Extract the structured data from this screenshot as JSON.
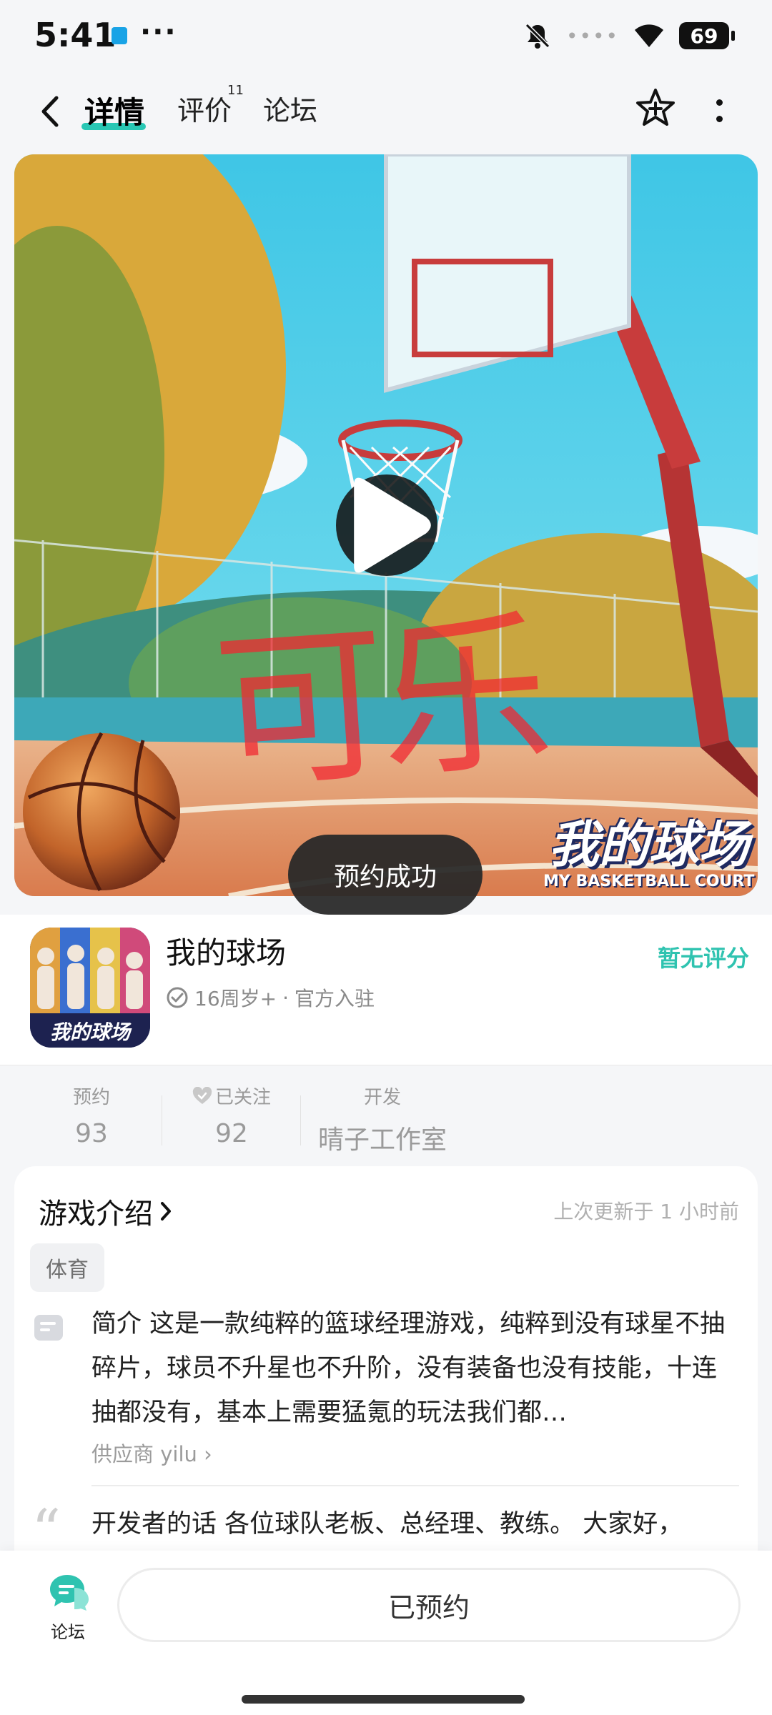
{
  "status_bar": {
    "time": "5:41",
    "more": "···",
    "signal_dots": "••••",
    "battery": "69"
  },
  "header": {
    "tabs": [
      {
        "label": "详情",
        "badge": ""
      },
      {
        "label": "评价",
        "badge": "11"
      },
      {
        "label": "论坛",
        "badge": ""
      }
    ]
  },
  "hero": {
    "watermark": "可乐",
    "logo_cn": "我的球场",
    "logo_en": "MY BASKETBALL COURT",
    "toast": "预约成功"
  },
  "game": {
    "name": "我的球场",
    "age_rating": "16周岁+",
    "official": "官方入驻",
    "rating": "暂无评分",
    "icon_caption": "我的球场"
  },
  "stats": [
    {
      "label": "预约",
      "value": "93"
    },
    {
      "label": "已关注",
      "value": "92"
    },
    {
      "label": "开发",
      "value": "晴子工作室"
    }
  ],
  "intro": {
    "title": "游戏介绍",
    "updated": "上次更新于 1 小时前",
    "tag": "体育",
    "desc_label": "简介",
    "desc": "这是一款纯粹的篮球经理游戏，纯粹到没有球星不抽碎片，球员不升星也不升阶，没有装备也没有技能，十连抽都没有，基本上需要猛氪的玩法我们都…",
    "supplier": "供应商 yilu",
    "dev_label": "开发者的话",
    "dev_words": "各位球队老板、总经理、教练。 大家好，"
  },
  "bottom": {
    "forum_label": "论坛",
    "reserve_label": "已预约"
  },
  "colors": {
    "accent": "#2fc3b0",
    "watermark": "#f02832"
  }
}
